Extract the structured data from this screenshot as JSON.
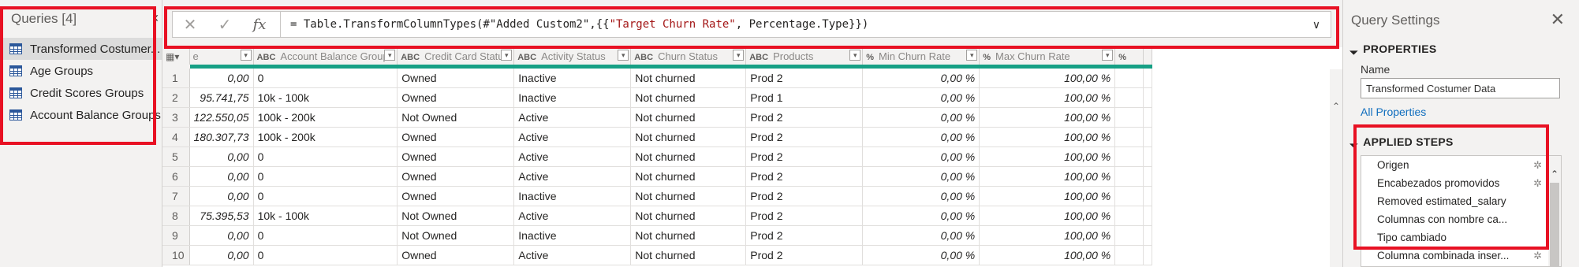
{
  "queries": {
    "header": "Queries [4]",
    "items": [
      {
        "label": "Transformed Costumer..."
      },
      {
        "label": "Age Groups"
      },
      {
        "label": "Credit Scores Groups"
      },
      {
        "label": "Account Balance Groups"
      }
    ]
  },
  "formula": {
    "fx": "fx",
    "prefix": "= Table.TransformColumnTypes(#\"Added Custom2\",{{",
    "string": "\"Target Churn Rate\"",
    "suffix": ", Percentage.Type}})"
  },
  "grid": {
    "columns": [
      {
        "label": "e",
        "type": ""
      },
      {
        "label": "Account Balance Groups",
        "type": "ABC"
      },
      {
        "label": "Credit Card Status",
        "type": "ABC"
      },
      {
        "label": "Activity Status",
        "type": "ABC"
      },
      {
        "label": "Churn Status",
        "type": "ABC"
      },
      {
        "label": "Products",
        "type": "ABC"
      },
      {
        "label": "Min Churn Rate",
        "type": "%"
      },
      {
        "label": "Max Churn Rate",
        "type": "%"
      },
      {
        "label": "",
        "type": "%"
      }
    ],
    "rows": [
      {
        "n": "1",
        "c": [
          "0,00",
          "0",
          "Owned",
          "Inactive",
          "Not churned",
          "Prod 2",
          "0,00 %",
          "100,00 %"
        ]
      },
      {
        "n": "2",
        "c": [
          "95.741,75",
          "10k - 100k",
          "Owned",
          "Inactive",
          "Not churned",
          "Prod 1",
          "0,00 %",
          "100,00 %"
        ]
      },
      {
        "n": "3",
        "c": [
          "122.550,05",
          "100k - 200k",
          "Not Owned",
          "Active",
          "Not churned",
          "Prod 2",
          "0,00 %",
          "100,00 %"
        ]
      },
      {
        "n": "4",
        "c": [
          "180.307,73",
          "100k - 200k",
          "Owned",
          "Active",
          "Not churned",
          "Prod 2",
          "0,00 %",
          "100,00 %"
        ]
      },
      {
        "n": "5",
        "c": [
          "0,00",
          "0",
          "Owned",
          "Active",
          "Not churned",
          "Prod 2",
          "0,00 %",
          "100,00 %"
        ]
      },
      {
        "n": "6",
        "c": [
          "0,00",
          "0",
          "Owned",
          "Active",
          "Not churned",
          "Prod 2",
          "0,00 %",
          "100,00 %"
        ]
      },
      {
        "n": "7",
        "c": [
          "0,00",
          "0",
          "Owned",
          "Inactive",
          "Not churned",
          "Prod 2",
          "0,00 %",
          "100,00 %"
        ]
      },
      {
        "n": "8",
        "c": [
          "75.395,53",
          "10k - 100k",
          "Not Owned",
          "Active",
          "Not churned",
          "Prod 2",
          "0,00 %",
          "100,00 %"
        ]
      },
      {
        "n": "9",
        "c": [
          "0,00",
          "0",
          "Not Owned",
          "Inactive",
          "Not churned",
          "Prod 2",
          "0,00 %",
          "100,00 %"
        ]
      },
      {
        "n": "10",
        "c": [
          "0,00",
          "0",
          "Owned",
          "Active",
          "Not churned",
          "Prod 2",
          "0,00 %",
          "100,00 %"
        ]
      }
    ]
  },
  "settings": {
    "title": "Query Settings",
    "properties_head": "PROPERTIES",
    "name_label": "Name",
    "name_value": "Transformed Costumer Data",
    "all_properties": "All Properties",
    "steps_head": "APPLIED STEPS",
    "steps": [
      {
        "label": "Origen",
        "gear": true
      },
      {
        "label": "Encabezados promovidos",
        "gear": true
      },
      {
        "label": "Removed estimated_salary",
        "gear": false
      },
      {
        "label": "Columnas con nombre ca...",
        "gear": false
      },
      {
        "label": "Tipo cambiado",
        "gear": false
      },
      {
        "label": "Columna combinada inser...",
        "gear": true
      }
    ]
  },
  "colors": {
    "highlight": "#e81123",
    "column_quality": "#16a085",
    "link": "#106ebe"
  }
}
